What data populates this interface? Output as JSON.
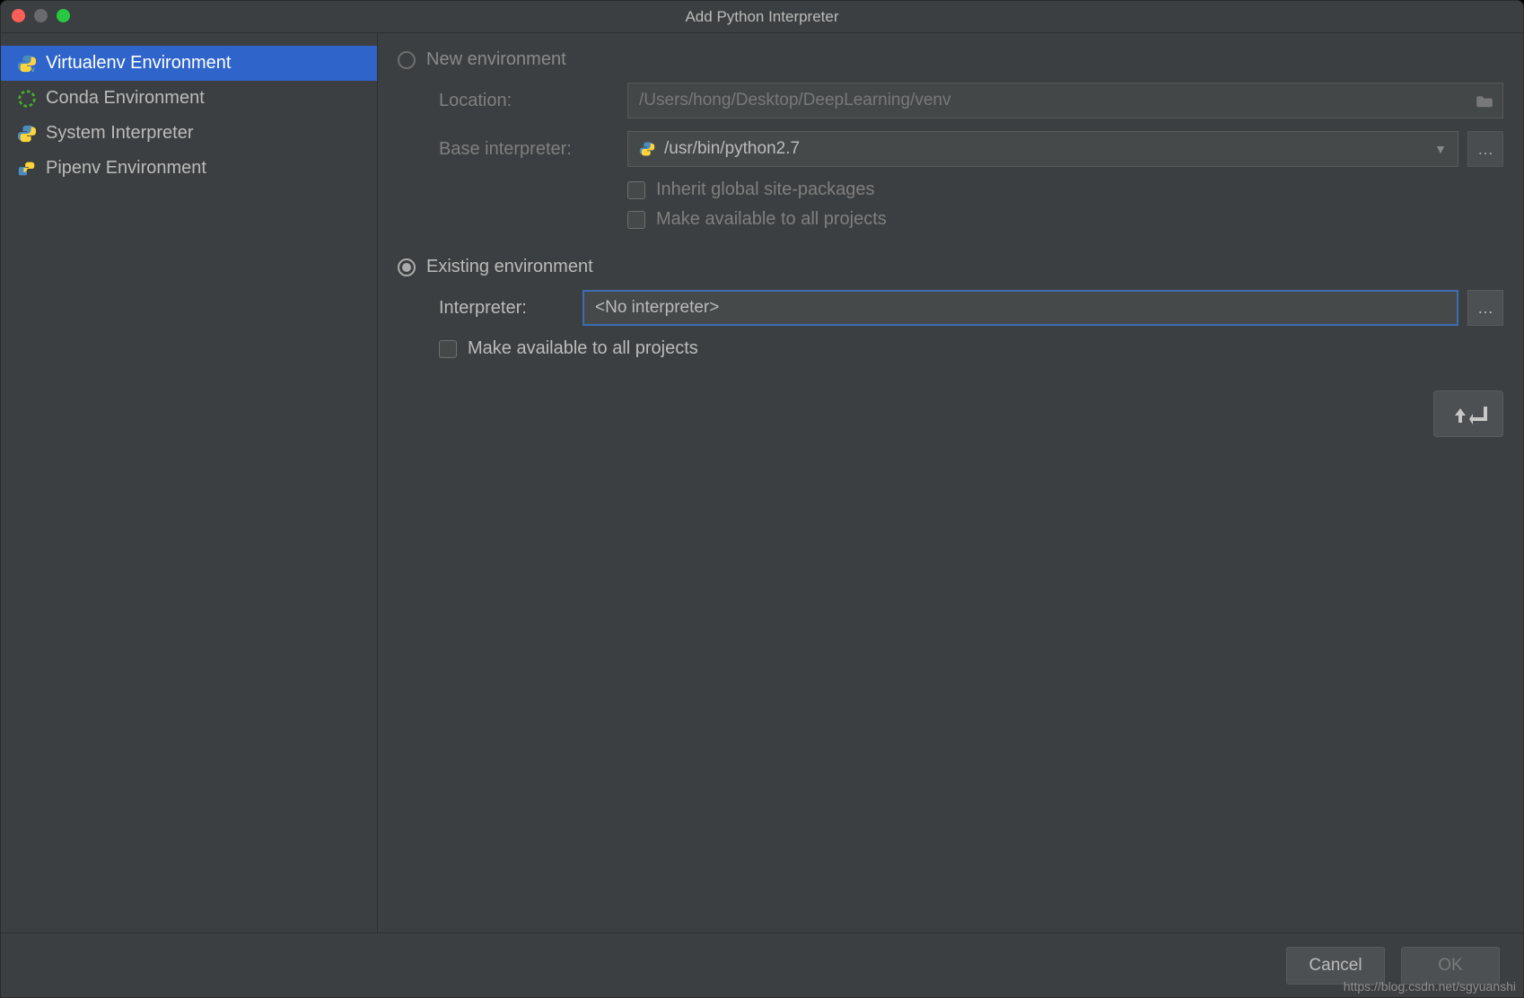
{
  "window": {
    "title": "Add Python Interpreter"
  },
  "sidebar": {
    "items": [
      {
        "label": "Virtualenv Environment",
        "icon": "python-venv-icon",
        "selected": true
      },
      {
        "label": "Conda Environment",
        "icon": "conda-icon",
        "selected": false
      },
      {
        "label": "System Interpreter",
        "icon": "python-icon",
        "selected": false
      },
      {
        "label": "Pipenv Environment",
        "icon": "pipenv-icon",
        "selected": false
      }
    ]
  },
  "new_env": {
    "radio_label": "New environment",
    "selected": false,
    "location_label": "Location:",
    "location_value": "/Users/hong/Desktop/DeepLearning/venv",
    "base_label": "Base interpreter:",
    "base_value": "/usr/bin/python2.7",
    "inherit_label": "Inherit global site-packages",
    "inherit_checked": false,
    "avail_label": "Make available to all projects",
    "avail_checked": false
  },
  "existing_env": {
    "radio_label": "Existing environment",
    "selected": true,
    "interpreter_label": "Interpreter:",
    "interpreter_value": "<No interpreter>",
    "avail_label": "Make available to all projects",
    "avail_checked": false
  },
  "hint": {
    "text": "⇧⏎"
  },
  "footer": {
    "cancel": "Cancel",
    "ok": "OK"
  },
  "watermark": "https://blog.csdn.net/sgyuanshi"
}
